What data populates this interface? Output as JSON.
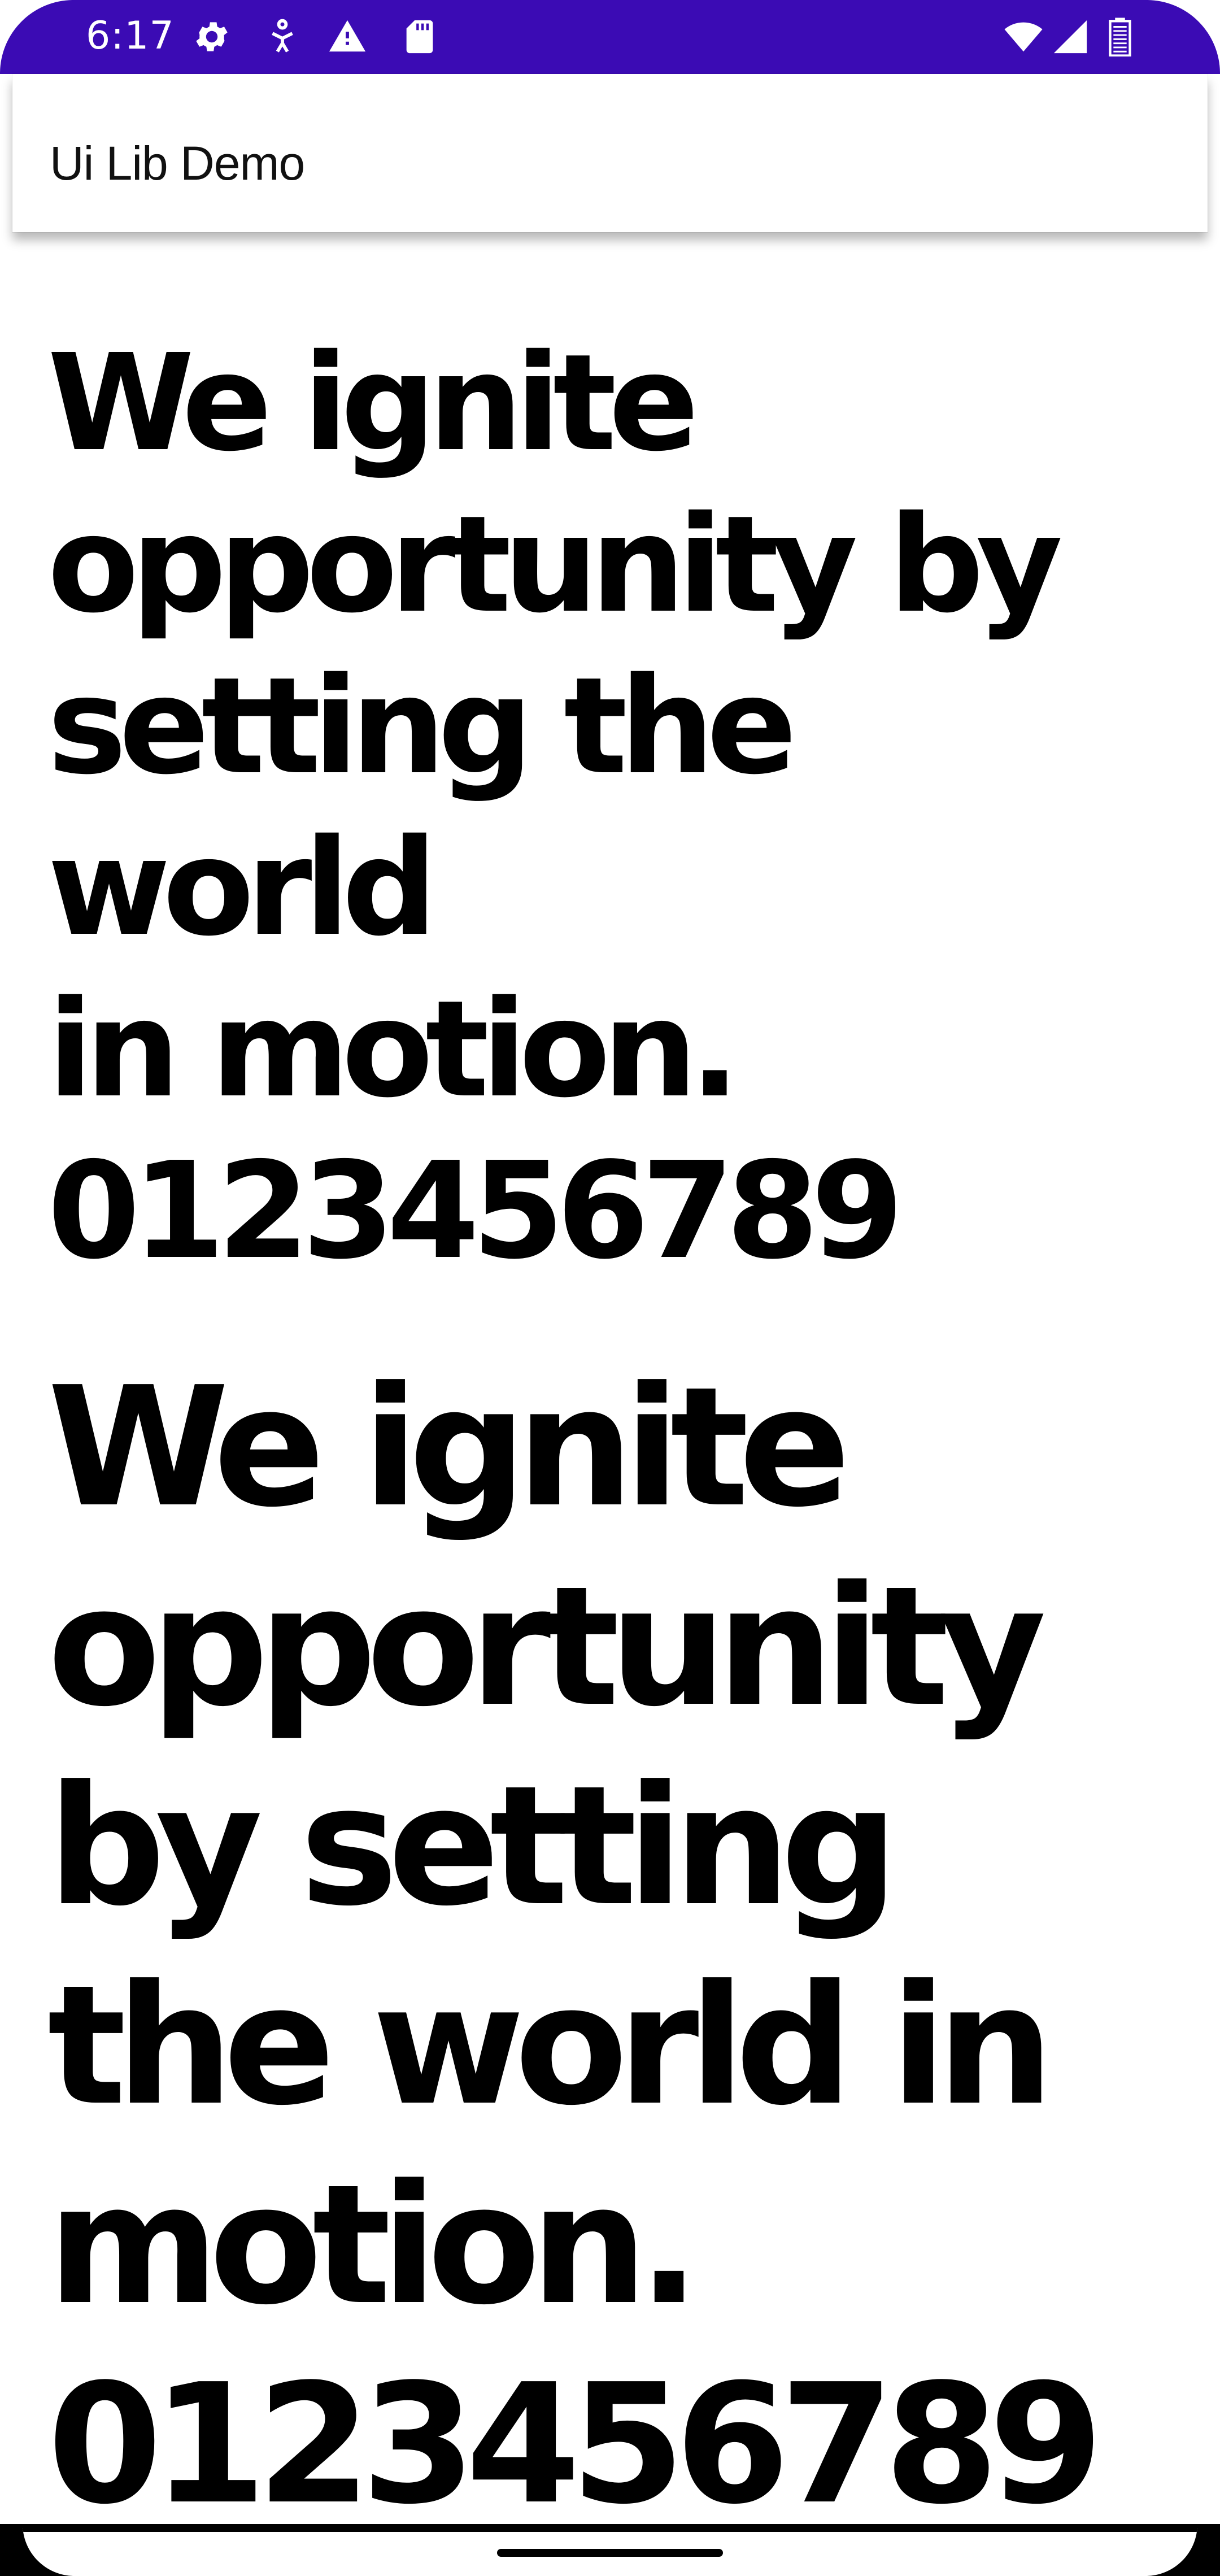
{
  "status_bar": {
    "time": "6:17",
    "icons": [
      "gear-icon",
      "accessibility-icon",
      "warning-icon",
      "sd-card-icon",
      "wifi-icon",
      "signal-icon",
      "battery-icon"
    ],
    "background_color": "#3b0bb4"
  },
  "app_bar": {
    "title": "Ui Lib Demo"
  },
  "content": {
    "headline_medium": "We ignite\nopportunity by\nsetting the world\nin motion.\n0123456789",
    "headline_large": "We ignite\nopportunity\nby setting\nthe world in\nmotion.\n0123456789"
  },
  "nav_bar": {
    "handle": "home-handle"
  }
}
